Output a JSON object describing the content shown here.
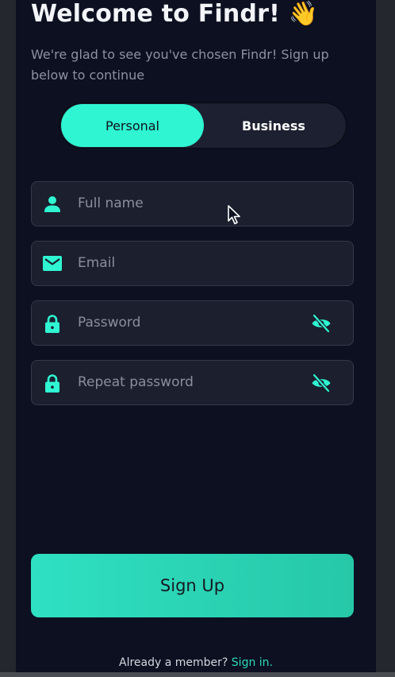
{
  "header": {
    "title": "Welcome to Findr!",
    "title_emoji": "👋",
    "subtitle": "We're glad to see you've chosen Findr! Sign up below to continue"
  },
  "account_type": {
    "options": [
      {
        "label": "Personal",
        "selected": true
      },
      {
        "label": "Business",
        "selected": false
      }
    ]
  },
  "form": {
    "full_name": {
      "placeholder": "Full name",
      "value": "",
      "icon": "person-icon"
    },
    "email": {
      "placeholder": "Email",
      "value": "",
      "icon": "mail-icon"
    },
    "password": {
      "placeholder": "Password",
      "value": "",
      "icon": "lock-icon",
      "toggle_icon": "eye-off-icon"
    },
    "repeat_password": {
      "placeholder": "Repeat password",
      "value": "",
      "icon": "lock-icon",
      "toggle_icon": "eye-off-icon"
    }
  },
  "actions": {
    "signup_label": "Sign Up"
  },
  "footer": {
    "prompt": "Already a member?",
    "link": "Sign in."
  },
  "colors": {
    "accent": "#2ff5d2",
    "background": "#0c1020",
    "field_background": "#1b1f2e"
  }
}
